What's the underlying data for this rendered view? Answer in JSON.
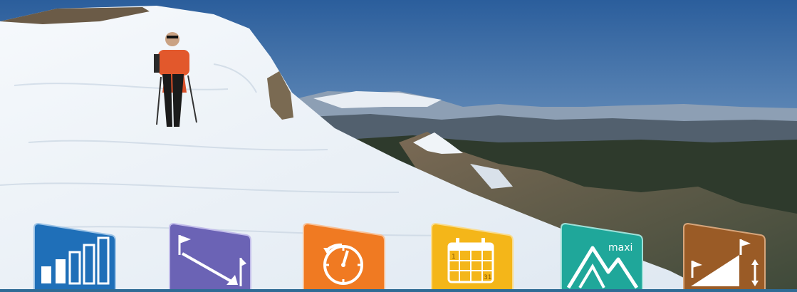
{
  "hero": {
    "colors": {
      "sky_top": "#2b5e9c",
      "sky_bottom": "#a9c4dc",
      "snow": "#eef3f8",
      "rock": "#6a5a46",
      "forest": "#2e3a2c"
    }
  },
  "icons": [
    {
      "icon": "difficulty-bars-icon",
      "color": "#1f6fb8"
    },
    {
      "icon": "distance-arrow-icon",
      "color": "#6b63b5"
    },
    {
      "icon": "duration-clock-icon",
      "color": "#f07a22"
    },
    {
      "icon": "calendar-icon",
      "color": "#f4b619",
      "text": [
        "1",
        "31"
      ]
    },
    {
      "icon": "max-altitude-icon",
      "color": "#1fa79a",
      "text": "maxi"
    },
    {
      "icon": "elevation-gain-icon",
      "color": "#9a5b26"
    }
  ]
}
